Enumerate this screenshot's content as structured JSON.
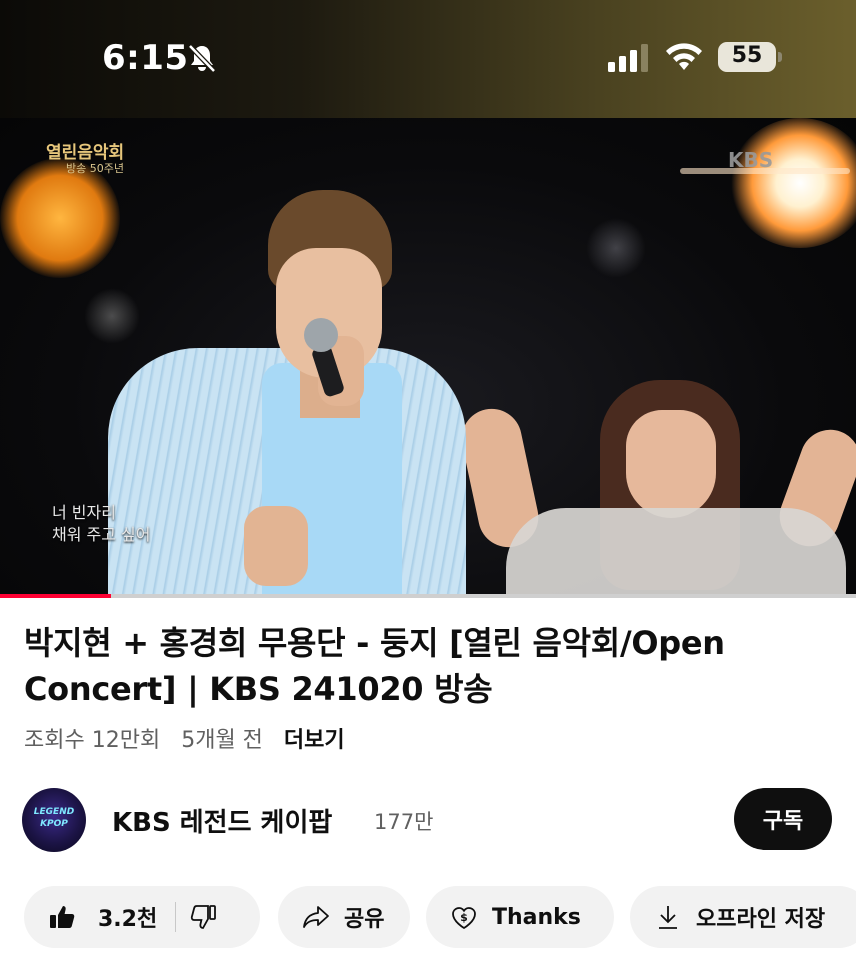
{
  "status_bar": {
    "time": "6:15",
    "battery": "55",
    "icons": [
      "bell-slash-icon",
      "cellular-signal-icon",
      "wifi-icon",
      "battery-icon"
    ]
  },
  "video": {
    "overlay_logo": "열린음악회",
    "overlay_logo_sub": "방송 50주년",
    "broadcaster_logo": "KBS",
    "subtitle": "너 빈자리\n채워 주고 싶어",
    "progress": 0.13,
    "progress_color": "#ff0033"
  },
  "info": {
    "title": "박지현 + 홍경희 무용단 - 둥지 [열린 음악회/Open Concert] | KBS 241020 방송",
    "views": "조회수 12만회",
    "age": "5개월 전",
    "more_label": "더보기"
  },
  "channel": {
    "name": "KBS 레전드 케이팝",
    "subscribers": "177만",
    "avatar_text": "LEGEND KPOP",
    "subscribe_label": "구독"
  },
  "actions": {
    "like_count": "3.2천",
    "share_label": "공유",
    "thanks_label": "Thanks",
    "download_label": "오프라인 저장"
  }
}
